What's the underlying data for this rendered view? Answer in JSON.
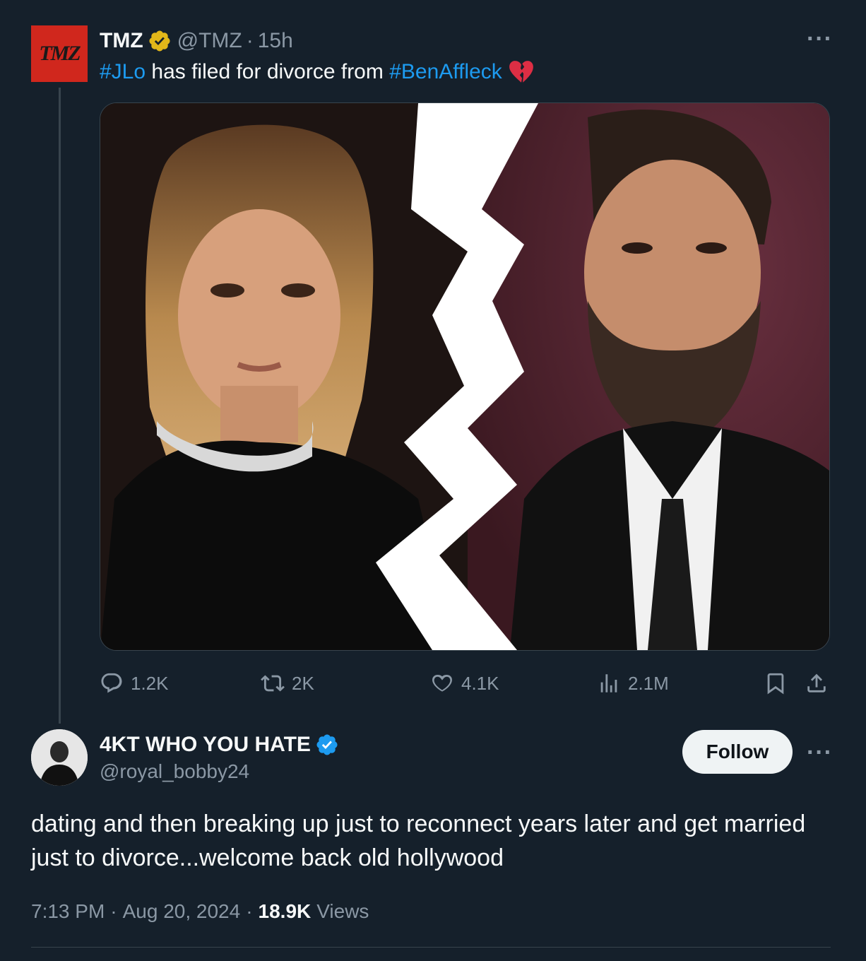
{
  "quoted_tweet": {
    "logo_text": "TMZ",
    "name": "TMZ",
    "handle": "@TMZ",
    "separator": "·",
    "time_ago": "15h",
    "more_label": "···",
    "text_parts": {
      "hashtag1": "#JLo",
      "middle": " has filed for divorce from ",
      "hashtag2": "#BenAffleck",
      "emoji_icon": "broken-heart-icon"
    },
    "stats": {
      "replies": "1.2K",
      "reposts": "2K",
      "likes": "4.1K",
      "views": "2.1M"
    },
    "badge_color": "#e2b719"
  },
  "main_tweet": {
    "name": "4KT WHO YOU HATE",
    "handle": "@royal_bobby24",
    "follow_label": "Follow",
    "more_label": "···",
    "text": "dating and then breaking up just to reconnect years later and get married just to divorce...welcome back old hollywood",
    "time": "7:13 PM",
    "separator": "·",
    "date": "Aug 20, 2024",
    "views_count": "18.9K",
    "views_label": "Views",
    "badge_color": "#1d9bf0"
  },
  "colors": {
    "background": "#15202b",
    "text": "#f7f9f9",
    "muted": "#8b98a5",
    "accent": "#1d9bf0",
    "tmz_red": "#d0271d"
  }
}
